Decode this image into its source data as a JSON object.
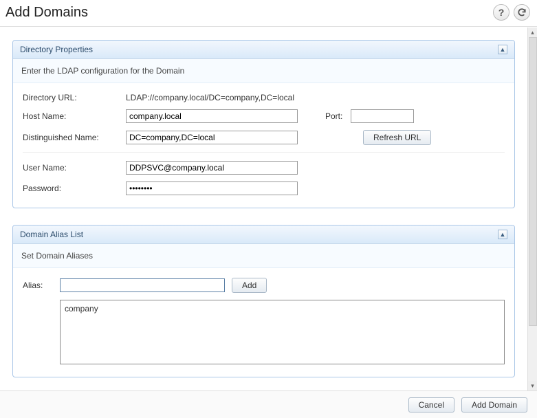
{
  "header": {
    "title": "Add Domains"
  },
  "panel1": {
    "title": "Directory Properties",
    "subtitle": "Enter the LDAP configuration for the Domain",
    "dirUrlLabel": "Directory URL:",
    "dirUrlValue": "LDAP://company.local/DC=company,DC=local",
    "hostLabel": "Host Name:",
    "hostValue": "company.local",
    "portLabel": "Port:",
    "portValue": "",
    "dnLabel": "Distinguished Name:",
    "dnValue": "DC=company,DC=local",
    "refreshBtn": "Refresh URL",
    "userLabel": "User Name:",
    "userValue": "DDPSVC@company.local",
    "passLabel": "Password:",
    "passValue": "••••••••"
  },
  "panel2": {
    "title": "Domain Alias List",
    "subtitle": "Set Domain Aliases",
    "aliasLabel": "Alias:",
    "aliasValue": "",
    "addBtn": "Add",
    "aliases": [
      "company"
    ]
  },
  "footer": {
    "cancel": "Cancel",
    "addDomain": "Add Domain"
  }
}
